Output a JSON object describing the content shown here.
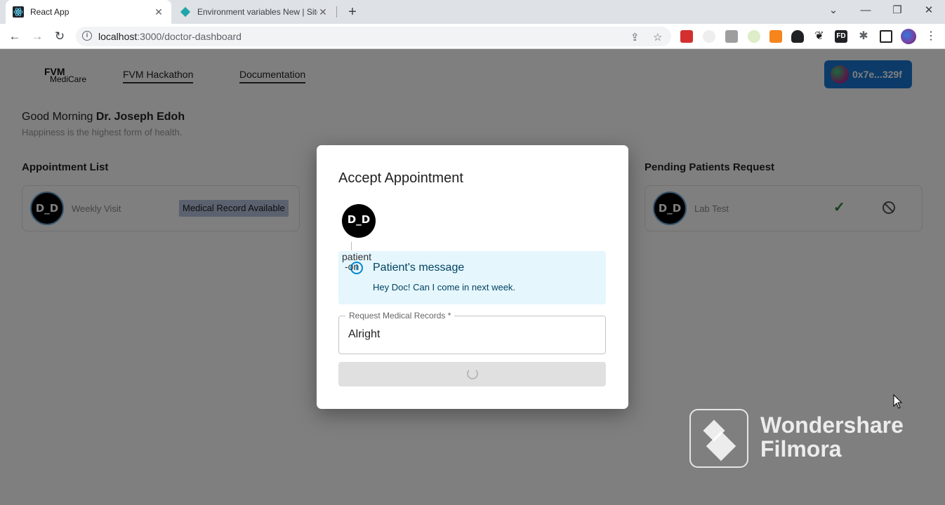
{
  "browser": {
    "tabs": [
      {
        "title": "React App",
        "icon": "react-icon",
        "active": true
      },
      {
        "title": "Environment variables New | Site",
        "icon": "netlify-icon",
        "active": false
      }
    ],
    "url_host": "localhost",
    "url_path": ":3000/doctor-dashboard",
    "window_controls": [
      "chevron-down-icon",
      "minimize-icon",
      "restore-icon",
      "close-icon"
    ],
    "extensions": [
      {
        "icon": "extension-red-icon",
        "color": "#d32f2f"
      },
      {
        "icon": "extension-face-icon",
        "color": "#9e9e9e"
      },
      {
        "icon": "extension-photo-icon",
        "color": "#8d8d8d"
      },
      {
        "icon": "extension-leaf-icon",
        "color": "#8bc34a"
      },
      {
        "icon": "metamask-icon",
        "color": "#f6851b"
      },
      {
        "icon": "angular-icon",
        "color": "#202124"
      },
      {
        "icon": "extension-bird-icon",
        "color": "#202124"
      },
      {
        "icon": "extension-fd-icon",
        "color": "#202124"
      },
      {
        "icon": "puzzle-icon",
        "color": "#5f6368"
      },
      {
        "icon": "sidepanel-icon",
        "color": "#202124"
      },
      {
        "icon": "profile-avatar-icon",
        "color": "#7b3fa0"
      }
    ]
  },
  "app": {
    "logo_main": "FVM",
    "logo_sub": "MediCare",
    "nav": [
      "FVM Hackathon",
      "Documentation"
    ],
    "wallet": "0x7e...329f",
    "greeting_prefix": "Good Morning",
    "doctor_name": "Dr. Joseph Edoh",
    "tagline": "Happiness is the highest form of health.",
    "appointment_title": "Appointment List",
    "appointment": {
      "avatar": "D_D",
      "label": "Weekly Visit",
      "chip": "Medical Record Available"
    },
    "pending_title": "Pending Patients Request",
    "pending": {
      "avatar": "D_D",
      "label": "Lab Test"
    }
  },
  "modal": {
    "title": "Accept Appointment",
    "avatar": "D_D",
    "patient_label_1": "patient",
    "patient_label_2": "-on",
    "message_title": "Patient's message",
    "message_body": "Hey Doc! Can I come in next week.",
    "field_label": "Request Medical Records *",
    "field_value": "Alright"
  },
  "watermark": {
    "line1": "Wondershare",
    "line2": "Filmora"
  }
}
